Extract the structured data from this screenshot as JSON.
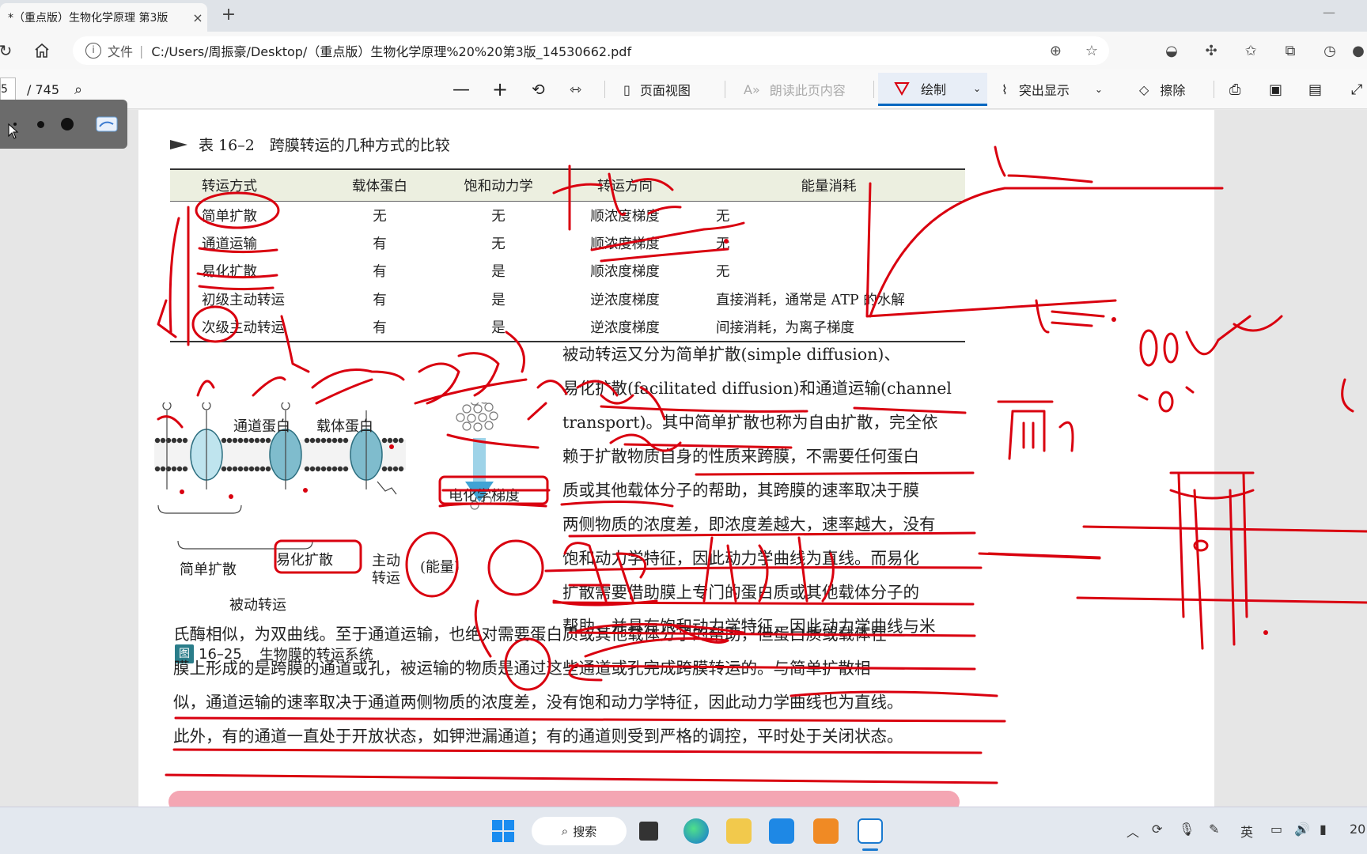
{
  "browser": {
    "tab_title": "*（重点版）生物化学原理 第3版",
    "tab_close": "×",
    "new_tab": "+",
    "address_label": "文件",
    "address_separator": "|",
    "url": "C:/Users/周振豪/Desktop/（重点版）生物化学原理%20%20第3版_14530662.pdf"
  },
  "pdf_toolbar": {
    "page_current": "5",
    "page_total": "/ 745",
    "page_view": "页面视图",
    "read_aloud": "朗读此页内容",
    "draw": "绘制",
    "highlight": "突出显示",
    "erase": "擦除"
  },
  "document": {
    "table_caption": "表 16–2　跨膜转运的几种方式的比较",
    "table_headers": [
      "转运方式",
      "载体蛋白",
      "饱和动力学",
      "转运方向",
      "能量消耗"
    ],
    "table_rows": [
      [
        "简单扩散",
        "无",
        "无",
        "顺浓度梯度",
        "无"
      ],
      [
        "通道运输",
        "有",
        "无",
        "顺浓度梯度",
        "无"
      ],
      [
        "易化扩散",
        "有",
        "是",
        "顺浓度梯度",
        "无"
      ],
      [
        "初级主动转运",
        "有",
        "是",
        "逆浓度梯度",
        "直接消耗，通常是 ATP 的水解"
      ],
      [
        "次级主动转运",
        "有",
        "是",
        "逆浓度梯度",
        "间接消耗，为离子梯度"
      ]
    ],
    "figure_labels": {
      "channel_protein": "通道蛋白",
      "carrier_protein": "载体蛋白",
      "gradient": "电化学梯度",
      "simple_diffusion": "简单扩散",
      "facilitated_diffusion": "易化扩散",
      "active_transport_1": "主动",
      "active_transport_2": "转运",
      "energy": "(能量)",
      "passive_transport": "被动转运"
    },
    "figure_caption_num": "16–25",
    "figure_caption_text": "生物膜的转运系统",
    "figure_badge": "图",
    "paragraph_right": [
      "被动转运又分为简单扩散(simple diffusion)、",
      "易化扩散(facilitated diffusion)和通道运输(channel",
      "transport)。其中简单扩散也称为自由扩散，完全依",
      "赖于扩散物质自身的性质来跨膜，不需要任何蛋白",
      "质或其他载体分子的帮助，其跨膜的速率取决于膜",
      "两侧物质的浓度差，即浓度差越大，速率越大，没有",
      "饱和动力学特征，因此动力学曲线为直线。而易化",
      "扩散需要借助膜上专门的蛋白质或其他载体分子的",
      "帮助，并具有饱和动力学特征，因此动力学曲线与米"
    ],
    "paragraph_full": [
      "氏酶相似，为双曲线。至于通道运输，也绝对需要蛋白质或其他载体分子的帮助，但蛋白质或载体在",
      "膜上形成的是跨膜的通道或孔，被运输的物质是通过这些通道或孔完成跨膜转运的。与简单扩散相",
      "似，通道运输的速率取决于通道两侧物质的浓度差，没有饱和动力学特征，因此动力学曲线也为直线。",
      "此外，有的通道一直处于开放状态，如钾泄漏通道；有的通道则受到严格的调控，平时处于关闭状态。"
    ]
  },
  "taskbar": {
    "search": "搜索",
    "ime": "英",
    "clock_fragment": "20"
  },
  "colors": {
    "ink": "#d9000f",
    "accent": "#0067c0",
    "highlight": "#f4a6b3"
  }
}
